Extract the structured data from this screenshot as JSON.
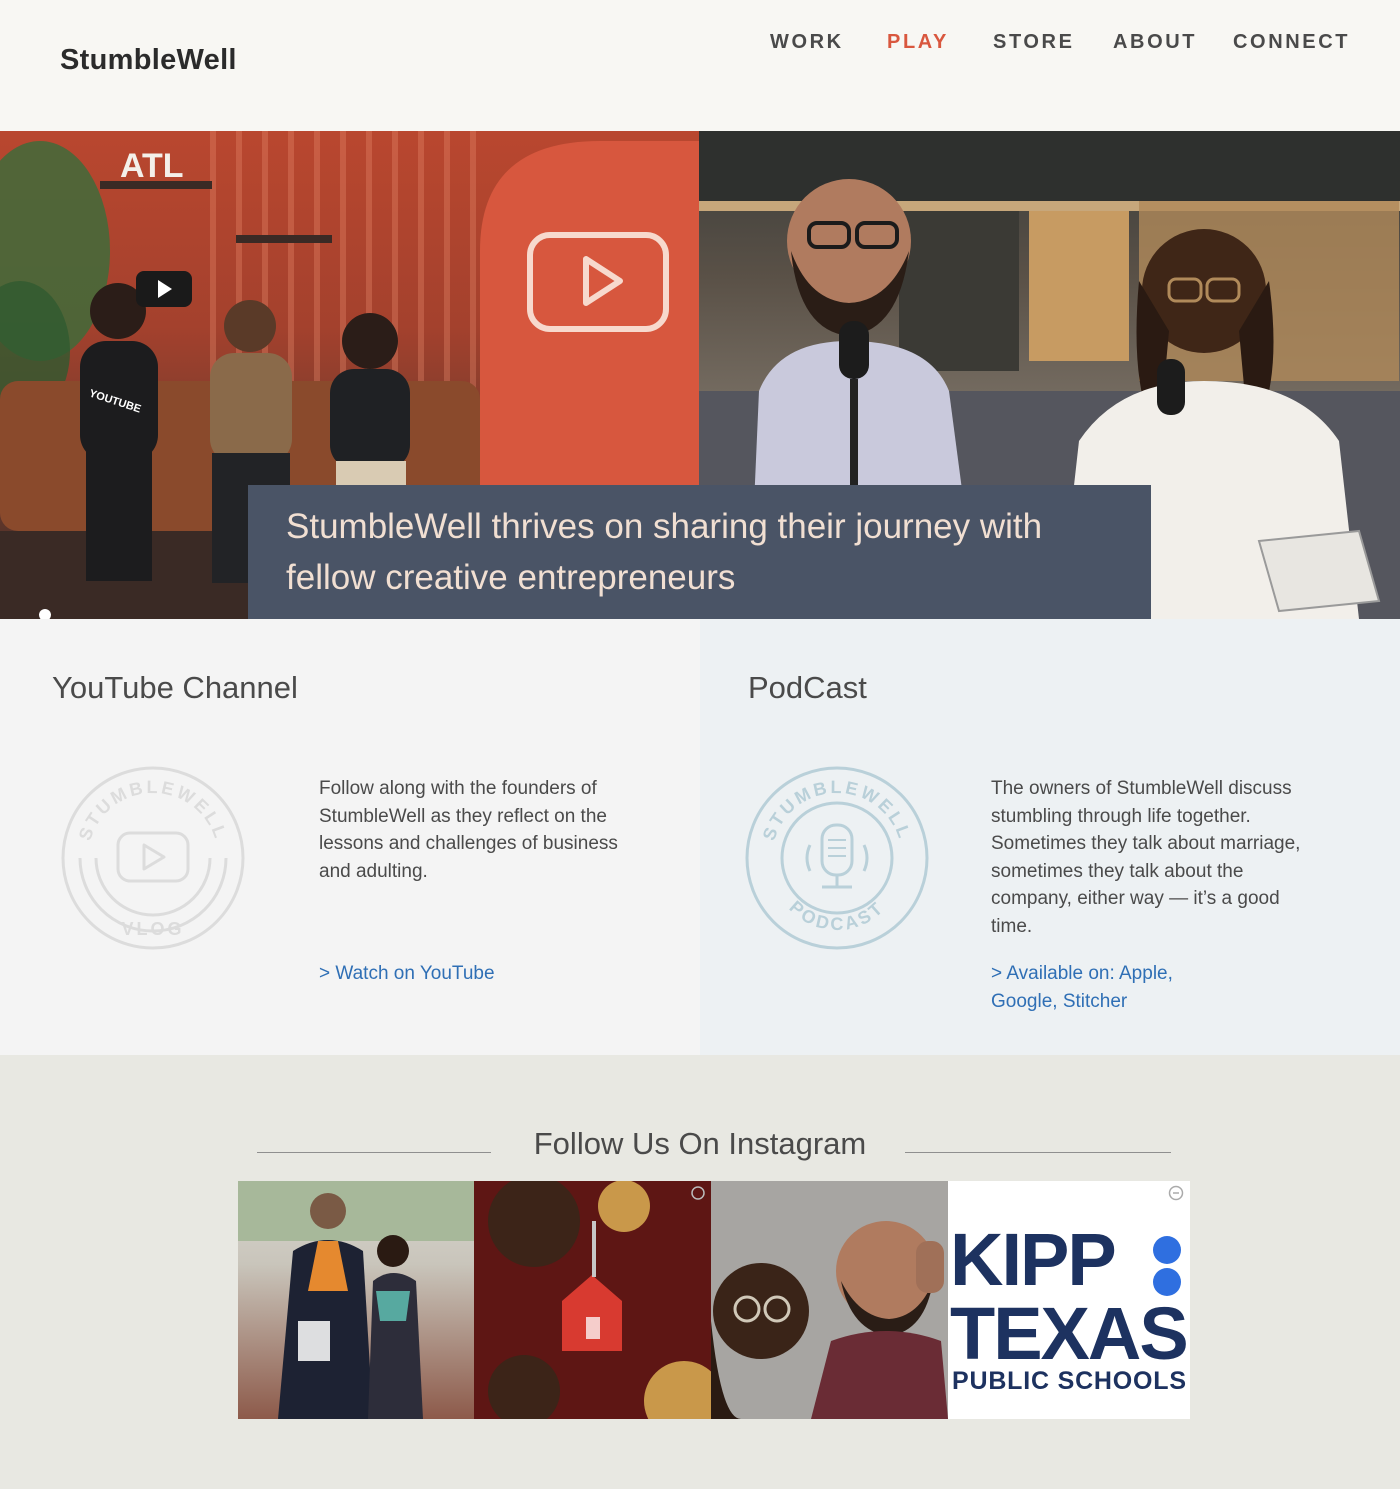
{
  "header": {
    "logo": "StumbleWell",
    "nav": [
      "WORK",
      "PLAY",
      "STORE",
      "ABOUT",
      "CONNECT"
    ],
    "active_nav": "PLAY"
  },
  "hero": {
    "caption": "StumbleWell thrives on sharing their journey with fellow creative entrepreneurs",
    "left_photo_sign": "ATL",
    "left_photo_shirt": "YOUTUBE"
  },
  "youtube": {
    "title": "YouTube Channel",
    "badge_top": "STUMBLEWELL",
    "badge_bottom": "VLOG",
    "description": "Follow along with the founders of StumbleWell as they reflect on the lessons and challenges of business and adulting.",
    "link": "> Watch on YouTube"
  },
  "podcast": {
    "title": "PodCast",
    "badge_top": "STUMBLEWELL",
    "badge_bottom": "PODCAST",
    "description": "The owners of StumbleWell discuss stumbling through life together.  Sometimes they talk about marriage, sometimes they talk about the company, either way — it’s a good time.",
    "link": "> Available on: Apple, Google, Stitcher"
  },
  "instagram": {
    "title": "Follow Us On Instagram",
    "kipp_line1": "KIPP",
    "kipp_line2": "TEXAS",
    "kipp_line3": "PUBLIC SCHOOLS"
  },
  "colors": {
    "accent": "#d9573e",
    "link": "#2f6fb5",
    "caption_bg": "#4a5466",
    "kipp_navy": "#1d3260",
    "kipp_blue": "#2f6fe0"
  }
}
